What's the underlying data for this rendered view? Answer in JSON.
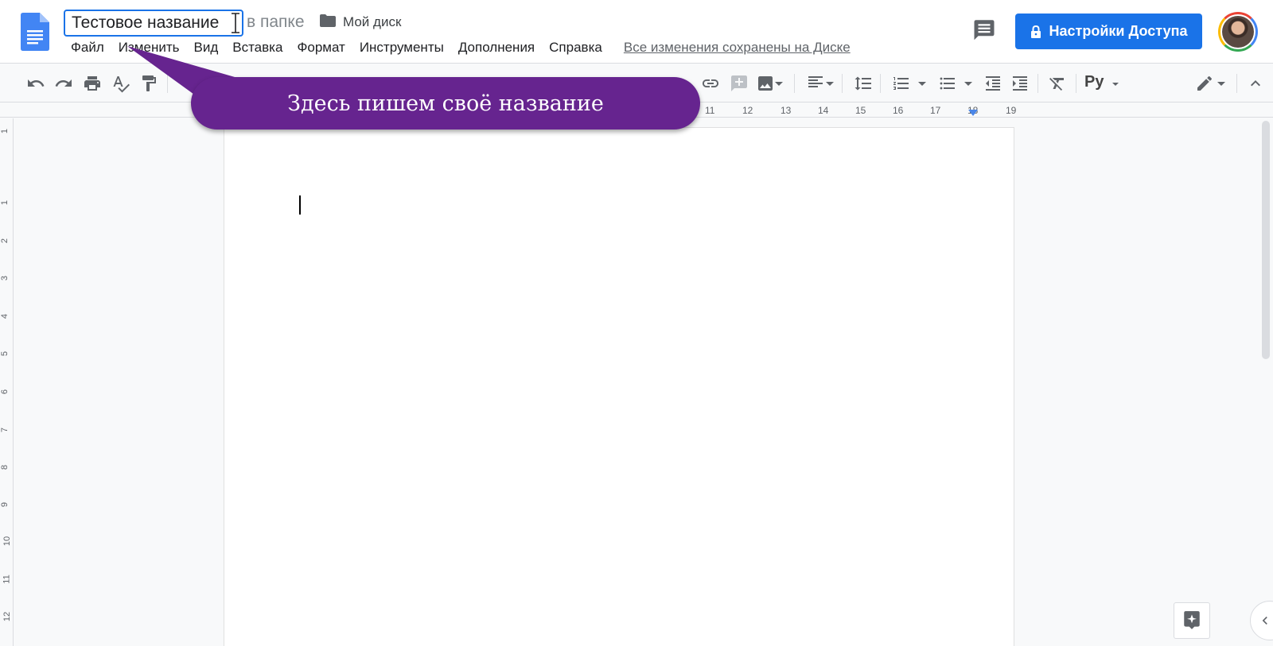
{
  "app": {
    "name": "Google Docs"
  },
  "header": {
    "title_value": "Тестовое название",
    "in_folder_text": "в папке",
    "folder_name": "Мой диск",
    "share_label": "Настройки Доступа"
  },
  "menu": {
    "items": [
      "Файл",
      "Изменить",
      "Вид",
      "Вставка",
      "Формат",
      "Инструменты",
      "Дополнения",
      "Справка"
    ],
    "save_status": "Все изменения сохранены на Диске"
  },
  "toolbar": {
    "language_label": "Ру",
    "icons": [
      "undo-icon",
      "redo-icon",
      "print-icon",
      "spellcheck-icon",
      "paint-format-icon",
      "link-icon",
      "add-comment-icon",
      "insert-image-icon",
      "align-icon",
      "line-spacing-icon",
      "numbered-list-icon",
      "bulleted-list-icon",
      "decrease-indent-icon",
      "increase-indent-icon",
      "clear-formatting-icon",
      "editing-mode-icon",
      "collapse-icon"
    ]
  },
  "ruler": {
    "h_ticks": [
      "11",
      "12",
      "13",
      "14",
      "15",
      "16",
      "17",
      "18",
      "19"
    ],
    "v_ticks": [
      "1",
      "1",
      "2",
      "3",
      "4",
      "5",
      "6",
      "7",
      "8",
      "9",
      "10",
      "11",
      "12"
    ]
  },
  "callout": {
    "text": "Здесь пишем своё название"
  },
  "colors": {
    "accent": "#1a73e8",
    "callout": "#66248f"
  }
}
